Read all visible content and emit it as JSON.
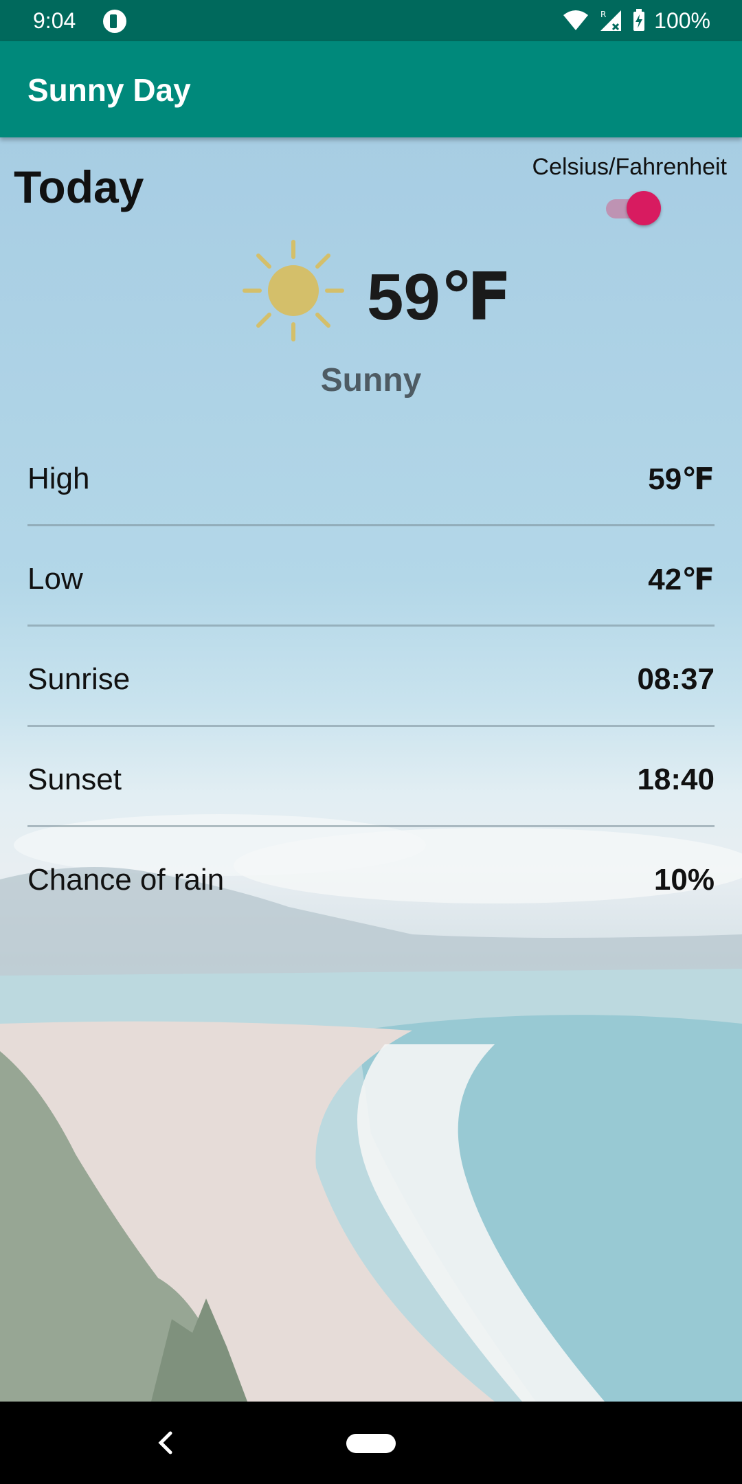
{
  "status_bar": {
    "time": "9:04",
    "battery": "100%",
    "icons": [
      "app-notification-icon",
      "wifi-icon",
      "cellular-roaming-icon",
      "battery-charging-icon"
    ]
  },
  "app_bar": {
    "title": "Sunny Day"
  },
  "main": {
    "heading": "Today",
    "unit_toggle": {
      "label": "Celsius/Fahrenheit",
      "on": true,
      "accent": "#d81b60"
    },
    "weather_icon": "sun-icon",
    "temperature": "59℉",
    "condition": "Sunny",
    "details": [
      {
        "label": "High",
        "value": "59℉"
      },
      {
        "label": "Low",
        "value": "42℉"
      },
      {
        "label": "Sunrise",
        "value": "08:37"
      },
      {
        "label": "Sunset",
        "value": "18:40"
      },
      {
        "label": "Chance of rain",
        "value": "10%"
      }
    ]
  },
  "colors": {
    "status_bar": "#00695C",
    "app_bar": "#00897B",
    "sun": "#d4bf6a"
  },
  "nav_bar": {
    "buttons": [
      "back-icon",
      "home-pill-icon"
    ]
  }
}
